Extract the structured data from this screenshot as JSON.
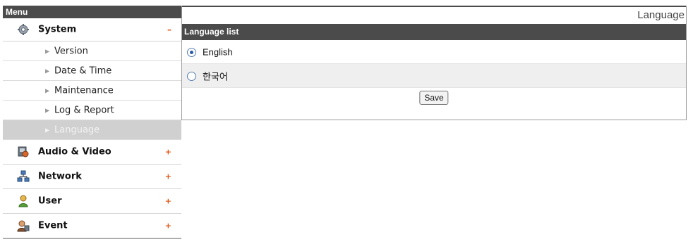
{
  "sidebar": {
    "header": "Menu",
    "groups": [
      {
        "label": "System",
        "toggle": "–",
        "icon": "gear-icon"
      },
      {
        "label": "Audio & Video",
        "toggle": "+",
        "icon": "camera-icon"
      },
      {
        "label": "Network",
        "toggle": "+",
        "icon": "network-icon"
      },
      {
        "label": "User",
        "toggle": "+",
        "icon": "user-icon"
      },
      {
        "label": "Event",
        "toggle": "+",
        "icon": "event-icon"
      }
    ],
    "system_items": [
      {
        "label": "Version"
      },
      {
        "label": "Date & Time"
      },
      {
        "label": "Maintenance"
      },
      {
        "label": "Log & Report"
      },
      {
        "label": "Language",
        "selected": true
      }
    ]
  },
  "main": {
    "title": "Language",
    "section": "Language list",
    "options": [
      {
        "label": "English",
        "checked": true
      },
      {
        "label": "한국어",
        "checked": false
      }
    ],
    "save_label": "Save"
  },
  "colors": {
    "header_bg": "#4b4b4b",
    "selected_item_bg": "#d0d0d0",
    "toggle_accent": "#e05a1a"
  }
}
